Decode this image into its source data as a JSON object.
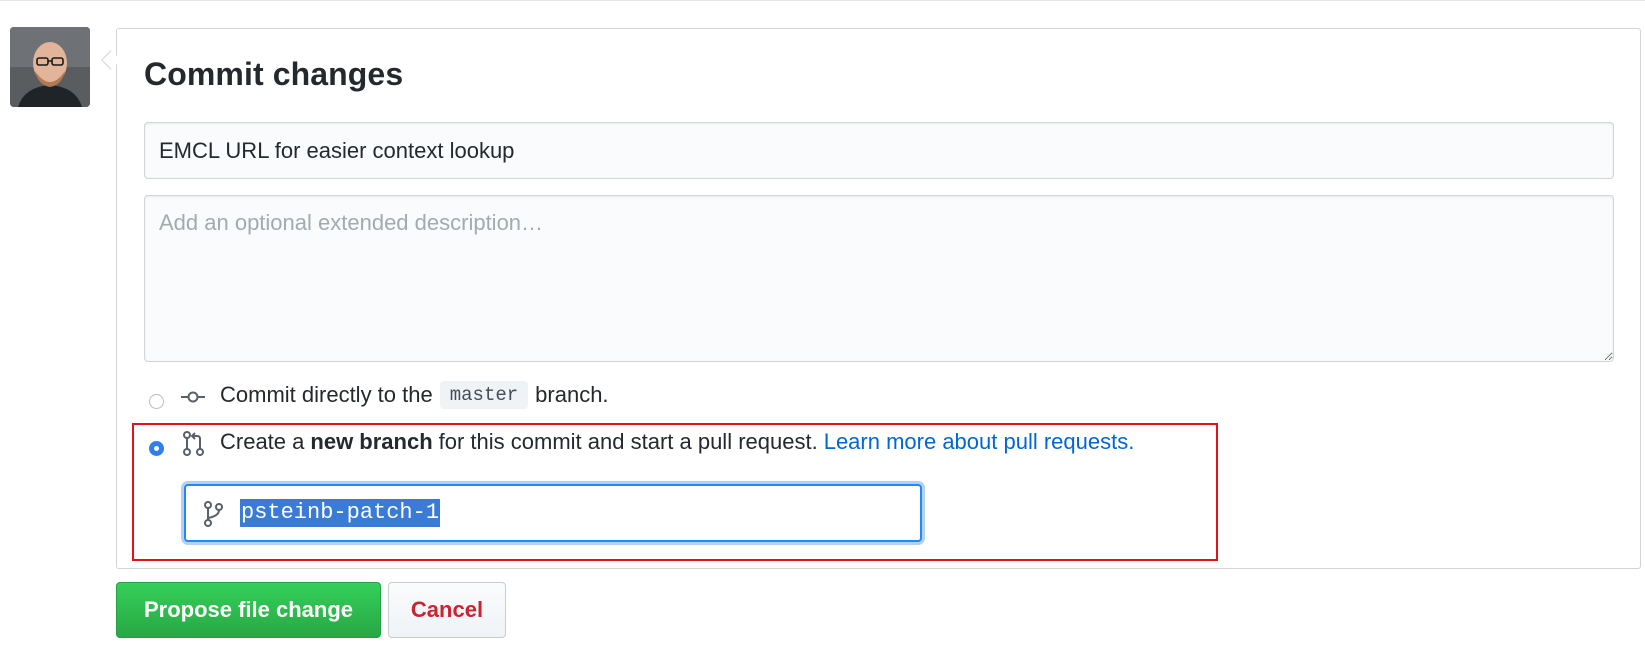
{
  "form": {
    "title": "Commit changes",
    "summary_value": "EMCL URL for easier context lookup",
    "description_placeholder": "Add an optional extended description…"
  },
  "options": {
    "direct": {
      "prefix": "Commit directly to the",
      "branch_name": "master",
      "suffix": "branch.",
      "icon": "git-commit-icon",
      "checked": false
    },
    "new_branch": {
      "prefix": "Create a",
      "bold": "new branch",
      "suffix": "for this commit and start a pull request.",
      "link": "Learn more about pull requests.",
      "icon": "git-pull-request-icon",
      "checked": true
    }
  },
  "branch_input": {
    "value": "psteinb-patch-1",
    "icon": "git-branch-icon"
  },
  "buttons": {
    "propose": "Propose file change",
    "cancel": "Cancel"
  },
  "colors": {
    "primary_green": "#2ea44f",
    "cancel_red": "#cb2431",
    "link_blue": "#0366d6",
    "highlight_red": "#e3111b",
    "focus_blue": "#2188ff"
  }
}
